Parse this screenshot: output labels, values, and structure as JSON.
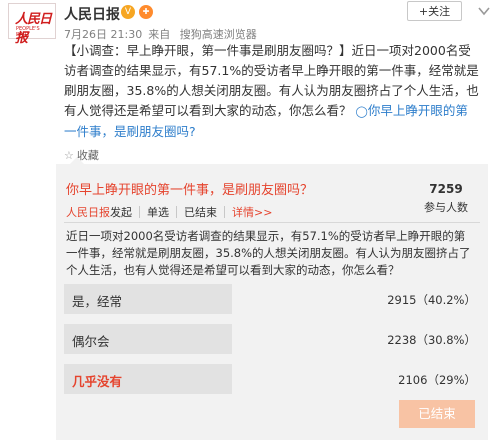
{
  "header": {
    "avatar_logo_cn": "人民日报",
    "avatar_logo_en": "PEOPLE'S DAILY",
    "user_name": "人民日报",
    "verified_badge": "V",
    "vip_badge": "✚",
    "time": "7月26日 21:30",
    "source_prefix": "来自",
    "source": "搜狗高速浏览器",
    "follow_label": "+关注",
    "menu_icon": "chevron-down-icon"
  },
  "post": {
    "topic": "【小调查：早上睁开眼，第一件事是刷朋友圈吗？】",
    "text": "近日一项对2000名受访者调查的结果显示，有57.1%的受访者早上睁开眼的第一件事，经常就是刷朋友圈，35.8%的人想关闭朋友圈。有人认为朋友圈挤占了个人生活，也有人觉得还是希望可以看到大家的动态，你怎么看？",
    "link_icon": "link-icon",
    "link_text": "你早上睁开眼的第一件事，是刷朋友圈吗?",
    "collect_label": "收藏",
    "collect_icon": "star-icon"
  },
  "vote": {
    "title": "你早上睁开眼的第一件事，是刷朋友圈吗？",
    "publisher": "人民日报",
    "publisher_suffix": "发起",
    "type": "单选",
    "status": "已结束",
    "detail_link": "详情>>",
    "count": "7259",
    "count_label": "参与人数",
    "description": "近日一项对2000名受访者调查的结果显示，有57.1%的受访者早上睁开眼的第一件事，经常就是刷朋友圈，35.8%的人想关闭朋友圈。有人认为朋友圈挤占了个人生活，也有人觉得还是希望可以看到大家的动态，你怎么看？",
    "options": [
      {
        "label": "是，经常",
        "result": "2915（40.2%）",
        "votes": 2915,
        "percent": 40.2
      },
      {
        "label": "偶尔会",
        "result": "2238（30.8%）",
        "votes": 2238,
        "percent": 30.8
      },
      {
        "label": "几乎没有",
        "result": "2106（29%）",
        "votes": 2106,
        "percent": 29
      }
    ],
    "ended_label": "已结束"
  },
  "colors": {
    "accent_red": "#e5442e",
    "link_blue": "#2e7ecb",
    "ended_button": "#f8c3a4"
  }
}
